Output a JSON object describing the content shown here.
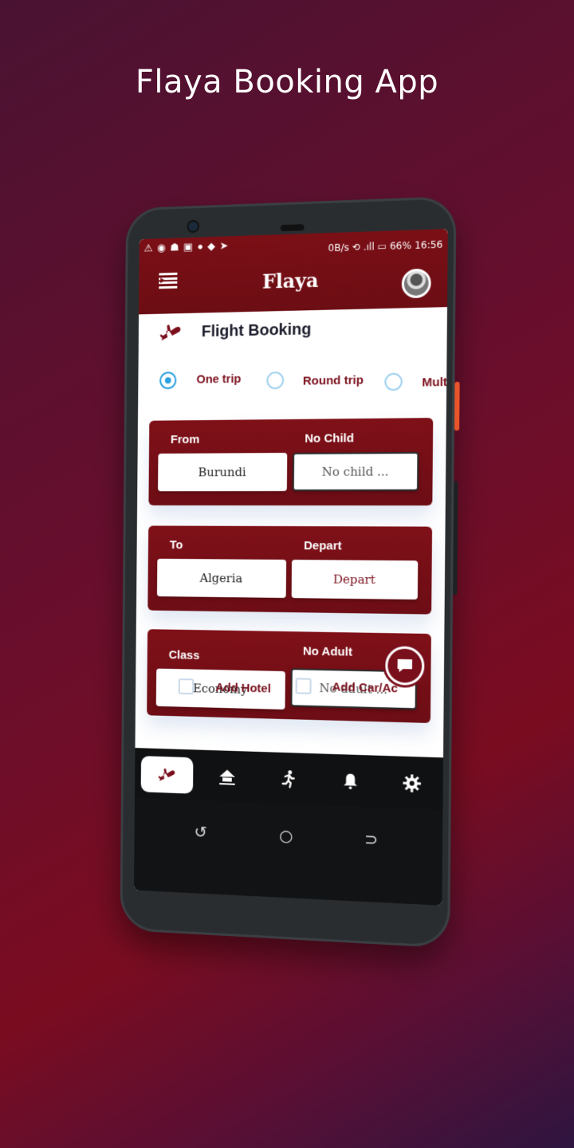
{
  "promo": {
    "title": "Flaya Booking App"
  },
  "status_bar": {
    "left_icons": "⚠ ◉ ☗ ▣ ● ◆ ➤",
    "right_text": "0B/s ⟲ .ıll ▭ 66% 16:56"
  },
  "header": {
    "title": "Flaya"
  },
  "section": {
    "title": "Flight Booking"
  },
  "trip_types": [
    {
      "label": "One trip",
      "selected": true
    },
    {
      "label": "Round trip",
      "selected": false
    },
    {
      "label": "Mult",
      "selected": false
    }
  ],
  "cards": [
    {
      "left_label": "From",
      "left_value": "Burundi",
      "right_label": "No Child",
      "right_value": "No child ..."
    },
    {
      "left_label": "To",
      "left_value": "Algeria",
      "right_label": "Depart",
      "right_value": "Depart"
    },
    {
      "left_label": "Class",
      "left_value": "Economy",
      "right_label": "No Adult",
      "right_value": "No adult ..."
    }
  ],
  "checks": [
    {
      "label": "Add Hotel"
    },
    {
      "label": "Add Car/Ac"
    }
  ],
  "bottom_nav": [
    "flights-icon",
    "hotel-icon",
    "activity-icon",
    "notifications-icon",
    "settings-icon"
  ],
  "colors": {
    "brand": "#7a0f1c",
    "radio_accent": "#2aa0e0"
  }
}
